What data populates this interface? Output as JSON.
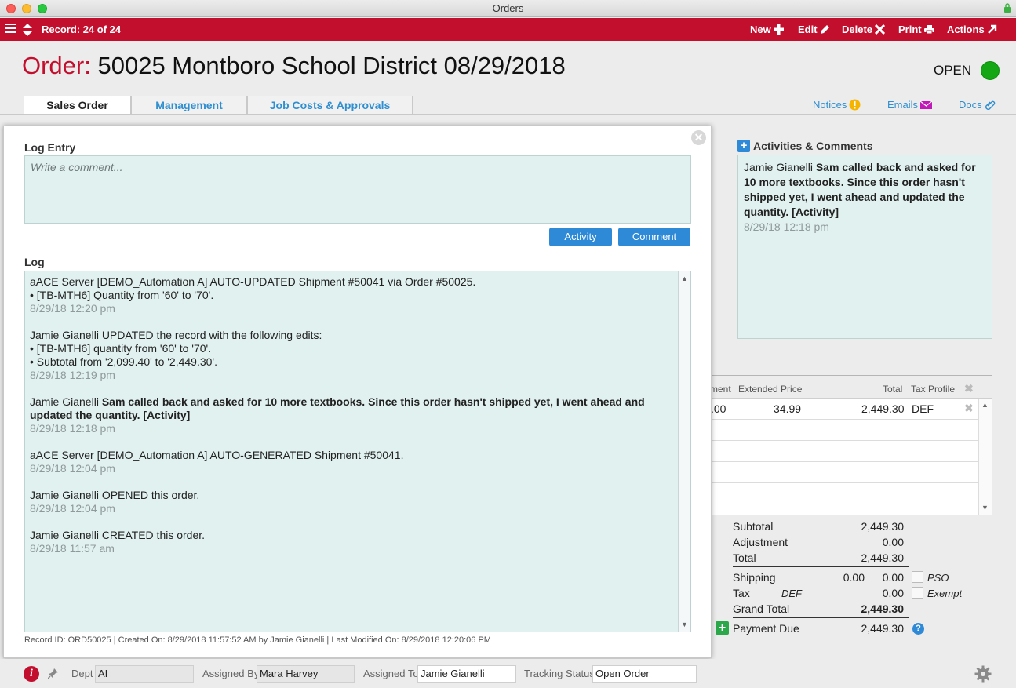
{
  "window": {
    "title": "Orders"
  },
  "toolbar": {
    "record": "Record: 24 of 24",
    "new": "New",
    "edit": "Edit",
    "delete": "Delete",
    "print": "Print",
    "actions": "Actions"
  },
  "header": {
    "label": "Order:",
    "title": "50025 Montboro School District  08/29/2018",
    "status": "OPEN",
    "status_color": "#13a713"
  },
  "tabs": [
    "Sales Order",
    "Management",
    "Job Costs & Approvals"
  ],
  "links": {
    "notices": "Notices",
    "emails": "Emails",
    "docs": "Docs"
  },
  "popup": {
    "entry_label": "Log Entry",
    "entry_placeholder": "Write a comment...",
    "activity_button": "Activity",
    "comment_button": "Comment",
    "log_label": "Log",
    "log": [
      {
        "lines": [
          "aACE Server [DEMO_Automation A] AUTO-UPDATED Shipment #50041 via Order #50025.",
          "• [TB-MTH6] Quantity from '60' to '70'."
        ],
        "time": "8/29/18   12:20 pm"
      },
      {
        "lines": [
          "Jamie Gianelli UPDATED the record with the following edits:",
          "• [TB-MTH6] quantity from '60' to '70'.",
          "• Subtotal from '2,099.40' to '2,449.30'."
        ],
        "time": "8/29/18   12:19 pm"
      },
      {
        "author": "Jamie Gianelli",
        "bold": "Sam called back and asked for 10 more textbooks. Since this order hasn't shipped yet, I went ahead and updated the quantity. [Activity]",
        "time": "8/29/18   12:18 pm"
      },
      {
        "lines": [
          "aACE Server [DEMO_Automation A] AUTO-GENERATED Shipment #50041."
        ],
        "time": "8/29/18   12:04 pm"
      },
      {
        "lines": [
          "Jamie Gianelli OPENED this order."
        ],
        "time": "8/29/18   12:04 pm"
      },
      {
        "lines": [
          "Jamie Gianelli CREATED this order."
        ],
        "time": "8/29/18   11:57 am"
      }
    ],
    "footer": "Record ID: ORD50025   |   Created On: 8/29/2018 11:57:52 AM by Jamie Gianelli   |   Last Modified On: 8/29/2018 12:20:06 PM"
  },
  "activities": {
    "title": "Activities & Comments",
    "author": "Jamie Gianelli",
    "text": "Sam called back and asked for 10 more textbooks. Since this order hasn't shipped yet, I went ahead and updated the quantity. [Activity]",
    "time": "8/29/18   12:18 pm"
  },
  "line_items": {
    "headers": {
      "adjustment_partial": "ment",
      "extended_price": "Extended Price",
      "total": "Total",
      "tax_profile": "Tax Profile"
    },
    "row": {
      "adjustment_partial": ".00",
      "extended_price": "34.99",
      "total": "2,449.30",
      "tax_profile": "DEF"
    }
  },
  "totals": {
    "subtotal_label": "Subtotal",
    "subtotal": "2,449.30",
    "adjustment_label": "Adjustment",
    "adjustment": "0.00",
    "total_label": "Total",
    "total": "2,449.30",
    "shipping_label": "Shipping",
    "shipping_a": "0.00",
    "shipping_b": "0.00",
    "pso_label": "PSO",
    "tax_label": "Tax",
    "tax_profile": "DEF",
    "tax": "0.00",
    "exempt_label": "Exempt",
    "grand_total_label": "Grand Total",
    "grand_total": "2,449.30",
    "payment_due_label": "Payment Due",
    "payment_due": "2,449.30"
  },
  "bottom": {
    "dept_label": "Dept",
    "dept": "AI",
    "assigned_by_label": "Assigned By",
    "assigned_by": "Mara Harvey",
    "assigned_to_label": "Assigned To",
    "assigned_to": "Jamie Gianelli",
    "tracking_label": "Tracking Status",
    "tracking": "Open Order"
  }
}
